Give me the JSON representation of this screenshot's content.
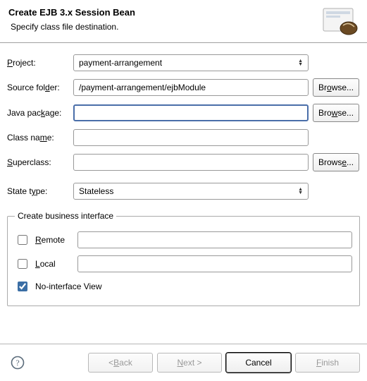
{
  "header": {
    "title": "Create EJB 3.x Session Bean",
    "subtitle": "Specify class file destination."
  },
  "form": {
    "project": {
      "label_pre": "",
      "label_u": "P",
      "label_post": "roject:",
      "value": "payment-arrangement"
    },
    "sourceFolder": {
      "label_pre": "Source fol",
      "label_u": "d",
      "label_post": "er:",
      "value": "/payment-arrangement/ejbModule",
      "browse_pre": "Br",
      "browse_u": "o",
      "browse_post": "wse..."
    },
    "javaPackage": {
      "label_pre": "Java pac",
      "label_u": "k",
      "label_post": "age:",
      "value": "",
      "browse_pre": "Bro",
      "browse_u": "w",
      "browse_post": "se..."
    },
    "className": {
      "label_pre": "Class na",
      "label_u": "m",
      "label_post": "e:",
      "value": ""
    },
    "superclass": {
      "label_pre": "",
      "label_u": "S",
      "label_post": "uperclass:",
      "value": "",
      "browse_pre": "Brows",
      "browse_u": "e",
      "browse_post": "..."
    },
    "stateType": {
      "label_pre": "State t",
      "label_u": "y",
      "label_post": "pe:",
      "value": "Stateless"
    }
  },
  "businessInterface": {
    "legend": "Create business interface",
    "remote": {
      "label_pre": "",
      "label_u": "R",
      "label_post": "emote",
      "checked": false,
      "value": ""
    },
    "local": {
      "label_pre": "",
      "label_u": "L",
      "label_post": "ocal",
      "checked": false,
      "value": ""
    },
    "noInterface": {
      "label_pre": "No-",
      "label_u": "i",
      "label_post": "nterface View",
      "checked": true
    }
  },
  "buttons": {
    "back": {
      "pre": "< ",
      "u": "B",
      "post": "ack"
    },
    "next": {
      "pre": "",
      "u": "N",
      "post": "ext >"
    },
    "cancel": {
      "text": "Cancel"
    },
    "finish": {
      "pre": "",
      "u": "F",
      "post": "inish"
    }
  }
}
